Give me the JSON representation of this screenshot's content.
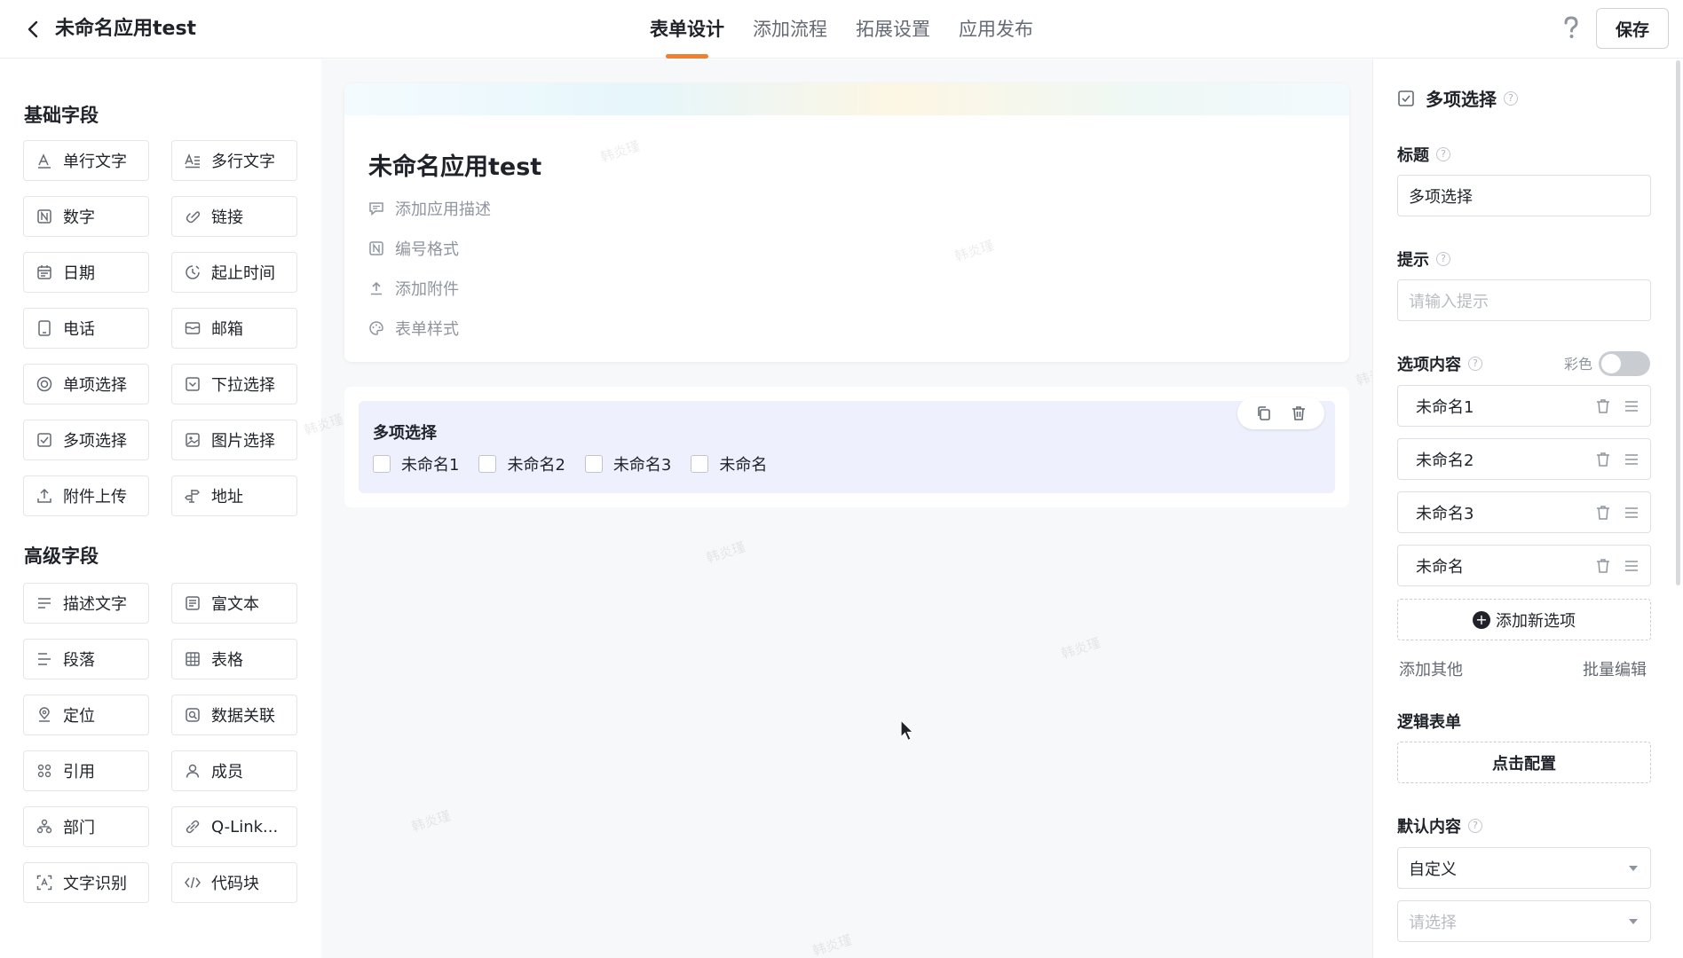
{
  "header": {
    "title": "未命名应用test",
    "tabs": [
      {
        "label": "表单设计",
        "active": true
      },
      {
        "label": "添加流程",
        "active": false
      },
      {
        "label": "拓展设置",
        "active": false
      },
      {
        "label": "应用发布",
        "active": false
      }
    ],
    "save_label": "保存"
  },
  "fields": {
    "basic_title": "基础字段",
    "basic": [
      {
        "label": "单行文字",
        "icon": "text-a-icon"
      },
      {
        "label": "多行文字",
        "icon": "multiline-text-icon"
      },
      {
        "label": "数字",
        "icon": "number-icon"
      },
      {
        "label": "链接",
        "icon": "link-icon"
      },
      {
        "label": "日期",
        "icon": "calendar-icon"
      },
      {
        "label": "起止时间",
        "icon": "time-range-icon"
      },
      {
        "label": "电话",
        "icon": "phone-icon"
      },
      {
        "label": "邮箱",
        "icon": "mail-icon"
      },
      {
        "label": "单项选择",
        "icon": "radio-icon"
      },
      {
        "label": "下拉选择",
        "icon": "dropdown-icon"
      },
      {
        "label": "多项选择",
        "icon": "checkbox-icon"
      },
      {
        "label": "图片选择",
        "icon": "image-icon"
      },
      {
        "label": "附件上传",
        "icon": "upload-icon"
      },
      {
        "label": "地址",
        "icon": "location-pin-icon"
      }
    ],
    "advanced_title": "高级字段",
    "advanced": [
      {
        "label": "描述文字",
        "icon": "description-icon"
      },
      {
        "label": "富文本",
        "icon": "rich-text-icon"
      },
      {
        "label": "段落",
        "icon": "paragraph-icon"
      },
      {
        "label": "表格",
        "icon": "table-icon"
      },
      {
        "label": "定位",
        "icon": "geolocation-icon"
      },
      {
        "label": "数据关联",
        "icon": "data-link-icon"
      },
      {
        "label": "引用",
        "icon": "reference-icon"
      },
      {
        "label": "成员",
        "icon": "member-icon"
      },
      {
        "label": "部门",
        "icon": "department-icon"
      },
      {
        "label": "Q-Link...",
        "icon": "qlink-icon"
      },
      {
        "label": "文字识别",
        "icon": "ocr-icon"
      },
      {
        "label": "代码块",
        "icon": "code-icon"
      }
    ]
  },
  "form": {
    "name": "未命名应用test",
    "meta": [
      {
        "label": "添加应用描述",
        "icon": "comment-icon"
      },
      {
        "label": "编号格式",
        "icon": "number-format-icon"
      },
      {
        "label": "添加附件",
        "icon": "upload-icon"
      },
      {
        "label": "表单样式",
        "icon": "palette-icon"
      }
    ],
    "question": {
      "label": "多项选择",
      "options": [
        "未命名1",
        "未命名2",
        "未命名3",
        "未命名"
      ]
    },
    "watermark": "韩炎瑾"
  },
  "props": {
    "head": "多项选择",
    "title_label": "标题",
    "title_value": "多项选择",
    "hint_label": "提示",
    "hint_placeholder": "请输入提示",
    "options_label": "选项内容",
    "color_label": "彩色",
    "color_enabled": false,
    "options": [
      "未命名1",
      "未命名2",
      "未命名3",
      "未命名"
    ],
    "add_option": "添加新选项",
    "add_other": "添加其他",
    "bulk_edit": "批量编辑",
    "logic_label": "逻辑表单",
    "logic_button": "点击配置",
    "default_label": "默认内容",
    "default_value": "自定义",
    "default_placeholder": "请选择"
  }
}
